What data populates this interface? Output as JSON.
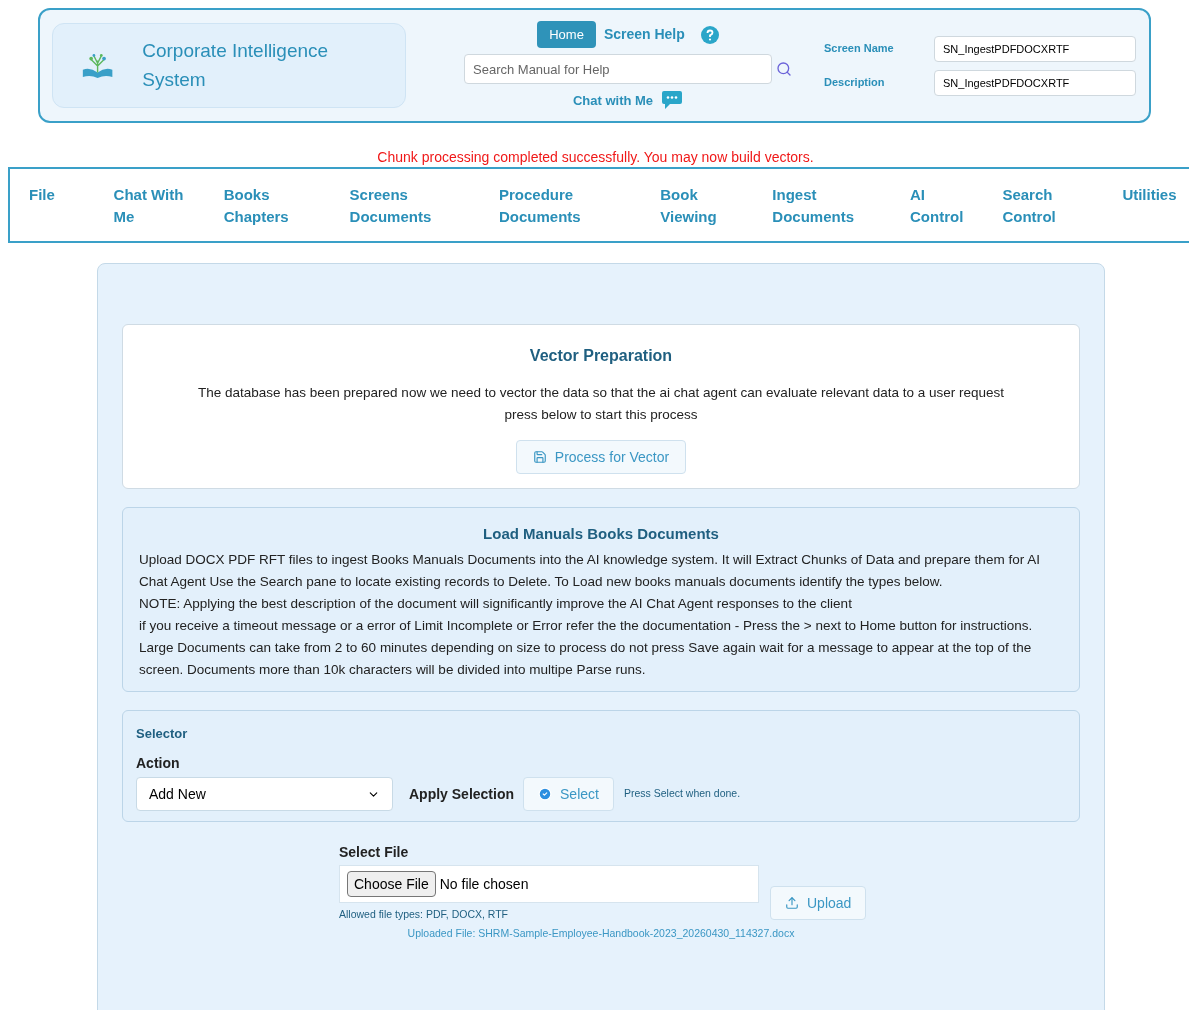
{
  "header": {
    "app_title": "Corporate Intelligence System",
    "home_button": "Home",
    "screen_help": "Screen Help",
    "search": {
      "placeholder": "Search Manual for Help"
    },
    "chat_link": "Chat with Me",
    "fields": [
      {
        "label": "Screen Name",
        "value": "SN_IngestPDFDOCXRTF"
      },
      {
        "label": "Description",
        "value": "SN_IngestPDFDOCXRTF"
      }
    ]
  },
  "status_message": "Chunk processing completed successfully. You may now build vectors.",
  "menu": [
    {
      "label": "File"
    },
    {
      "label": "Chat With\nMe"
    },
    {
      "label": "Books\nChapters"
    },
    {
      "label": "Screens\nDocuments"
    },
    {
      "label": "Procedure\nDocuments"
    },
    {
      "label": "Book\nViewing"
    },
    {
      "label": "Ingest\nDocuments"
    },
    {
      "label": "AI\nControl"
    },
    {
      "label": "Search\nControl"
    },
    {
      "label": "Utilities"
    }
  ],
  "vector_card": {
    "title": "Vector Preparation",
    "text": "The database has been prepared now we need to vector the data so that the ai chat agent can evaluate relevant data to a user request press below to start this process",
    "button": "Process for Vector"
  },
  "info_card": {
    "title": "Load Manuals Books Documents",
    "paragraphs": [
      "Upload DOCX PDF RFT files to ingest Books Manuals Documents into the AI knowledge system. It will Extract Chunks of Data and prepare them for AI Chat Agent Use the Search pane to locate existing records to Delete. To Load new books manuals documents identify the types below.",
      "NOTE: Applying the best description of the document will significantly improve the AI Chat Agent responses to the client",
      "if you receive a timeout message or a error of Limit Incomplete or Error refer the the documentation - Press the > next to Home button for instructions. Large Documents can take from 2 to 60 minutes depending on size to process do not press Save again wait for a message to appear at the top of the screen. Documents more than 10k characters will be divided into multipe Parse runs."
    ]
  },
  "selector": {
    "title": "Selector",
    "action_label": "Action",
    "action_value": "Add New",
    "apply_label": "Apply Selection",
    "select_button": "Select",
    "hint": "Press Select when done."
  },
  "upload": {
    "label": "Select File",
    "choose_button": "Choose File",
    "file_status": "No file chosen",
    "allowed": "Allowed file types: PDF, DOCX, RTF",
    "upload_button": "Upload",
    "uploaded": "Uploaded File: SHRM-Sample-Employee-Handbook-2023_20260430_114327.docx"
  }
}
